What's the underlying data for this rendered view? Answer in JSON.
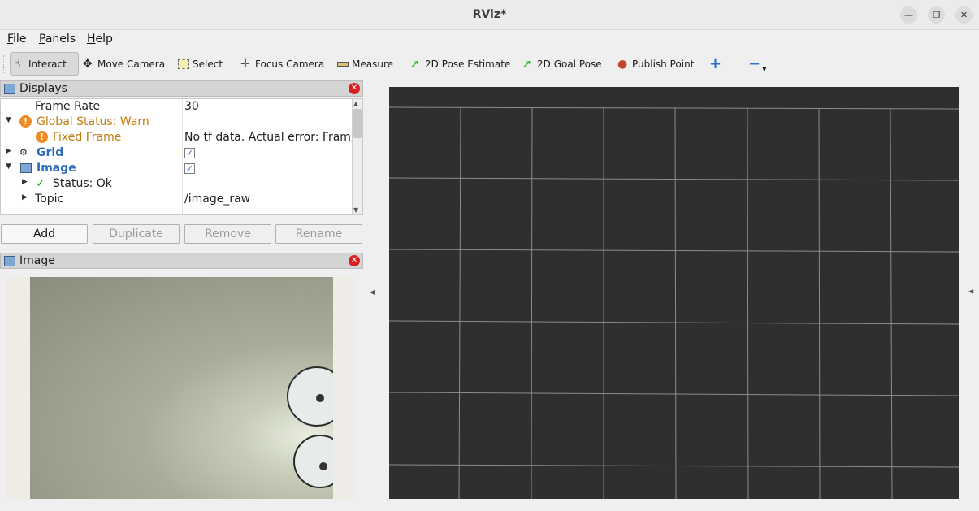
{
  "window": {
    "title": "RViz*"
  },
  "menu": [
    {
      "accel": "F",
      "rest": "ile"
    },
    {
      "accel": "P",
      "rest": "anels"
    },
    {
      "accel": "H",
      "rest": "elp"
    }
  ],
  "toolbar": {
    "interact": "Interact",
    "move_camera": "Move Camera",
    "select": "Select",
    "focus_camera": "Focus Camera",
    "measure": "Measure",
    "pose_estimate": "2D Pose Estimate",
    "goal_pose": "2D Goal Pose",
    "publish_point": "Publish Point",
    "add_tool_glyph": "+",
    "remove_tool_glyph": "−"
  },
  "displays_panel": {
    "title": "Displays",
    "rows": {
      "frame_rate": {
        "name": "Frame Rate",
        "value": "30"
      },
      "global_status": {
        "name": "Global Status: Warn"
      },
      "fixed_frame": {
        "name": "Fixed Frame",
        "value": "No tf data.  Actual error: Fram..."
      },
      "grid": {
        "name": "Grid",
        "checked": true
      },
      "image": {
        "name": "Image",
        "checked": true
      },
      "status": {
        "name": "Status: Ok"
      },
      "topic": {
        "name": "Topic",
        "value": "/image_raw"
      }
    },
    "buttons": {
      "add": "Add",
      "duplicate": "Duplicate",
      "remove": "Remove",
      "rename": "Rename"
    }
  },
  "image_panel": {
    "title": "Image"
  },
  "colors": {
    "warn": "#f08a24",
    "link_blue": "#2c6dbd",
    "view_bg": "#2f2f2f",
    "grid_line": "#8c8c8c"
  }
}
